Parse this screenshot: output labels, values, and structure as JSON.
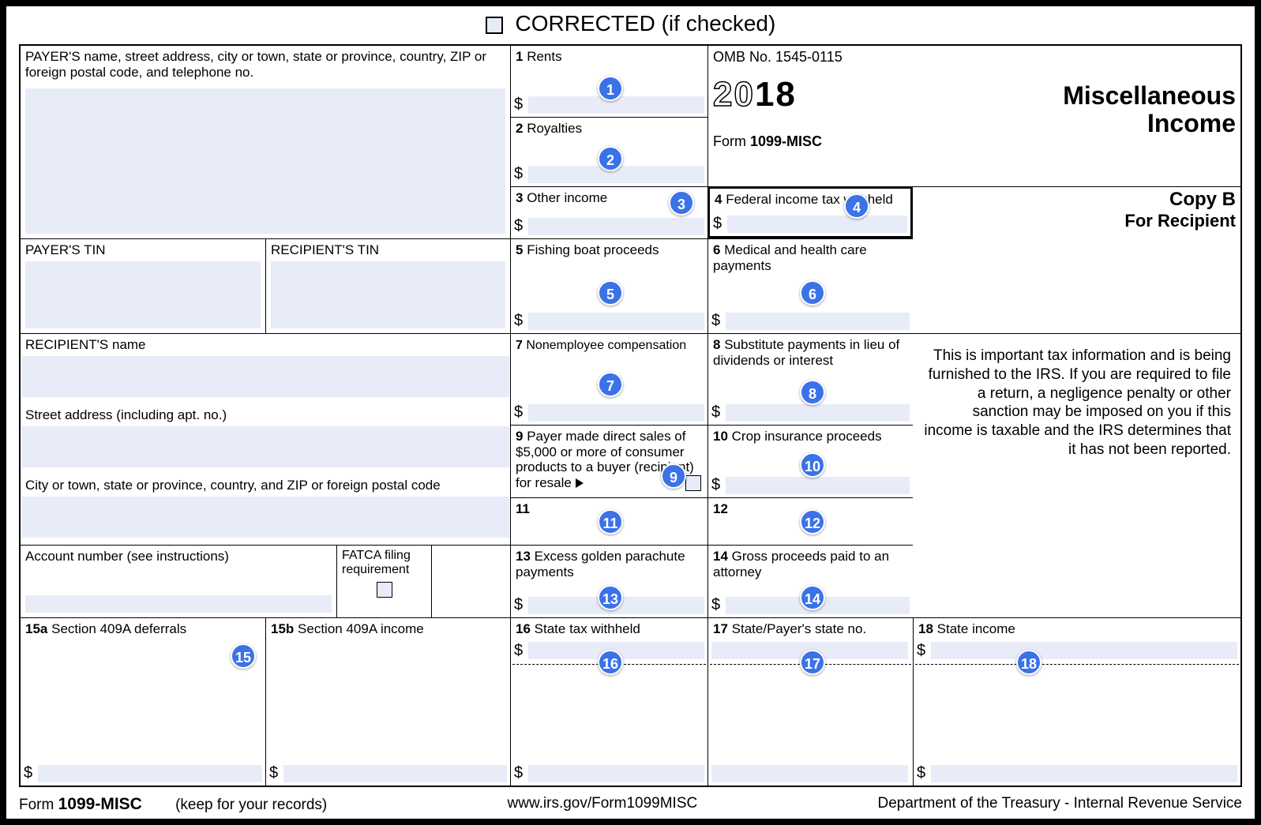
{
  "header": {
    "corrected_label": "CORRECTED (if checked)"
  },
  "payer": {
    "info_label": "PAYER'S name, street address, city or town, state or province, country, ZIP or foreign postal code, and telephone no.",
    "tin_label": "PAYER'S TIN"
  },
  "recipient": {
    "tin_label": "RECIPIENT'S TIN",
    "name_label": "RECIPIENT'S name",
    "street_label": "Street address (including apt. no.)",
    "city_label": "City or town, state or province, country, and ZIP or foreign postal code",
    "account_label": "Account number (see instructions)",
    "fatca_label": "FATCA filing requirement"
  },
  "boxes": {
    "b1": {
      "num": "1",
      "label": "Rents"
    },
    "b2": {
      "num": "2",
      "label": "Royalties"
    },
    "b3": {
      "num": "3",
      "label": "Other income"
    },
    "b4": {
      "num": "4",
      "label": "Federal income tax withheld"
    },
    "b5": {
      "num": "5",
      "label": "Fishing boat proceeds"
    },
    "b6": {
      "num": "6",
      "label": "Medical and health care payments"
    },
    "b7": {
      "num": "7",
      "label": "Nonemployee compensation"
    },
    "b8": {
      "num": "8",
      "label": "Substitute payments in lieu of dividends or interest"
    },
    "b9": {
      "num": "9",
      "label": "Payer made direct sales of $5,000 or more of consumer products to a buyer (recipient) for resale"
    },
    "b10": {
      "num": "10",
      "label": "Crop insurance proceeds"
    },
    "b11": {
      "num": "11",
      "label": ""
    },
    "b12": {
      "num": "12",
      "label": ""
    },
    "b13": {
      "num": "13",
      "label": "Excess golden parachute payments"
    },
    "b14": {
      "num": "14",
      "label": "Gross proceeds paid to an attorney"
    },
    "b15a": {
      "num": "15a",
      "label": "Section 409A deferrals"
    },
    "b15b": {
      "num": "15b",
      "label": "Section 409A income"
    },
    "b16": {
      "num": "16",
      "label": "State tax withheld"
    },
    "b17": {
      "num": "17",
      "label": "State/Payer's state no."
    },
    "b18": {
      "num": "18",
      "label": "State income"
    }
  },
  "right": {
    "omb": "OMB No. 1545-0115",
    "year_a": "20",
    "year_b": "18",
    "form_label_prefix": "Form ",
    "form_label": "1099-MISC",
    "title1": "Miscellaneous",
    "title2": "Income",
    "copyb": "Copy B",
    "for_recipient": "For Recipient",
    "tax_info": "This is important tax information and is being furnished to the IRS. If you are required to file a return, a negligence penalty or other sanction may be imposed on you if this income is taxable and the IRS determines that it has not been reported."
  },
  "footer": {
    "form_prefix": "Form ",
    "form": "1099-MISC",
    "keep": "(keep for your records)",
    "url": "www.irs.gov/Form1099MISC",
    "dept": "Department of the Treasury - Internal Revenue Service"
  },
  "annotations": {
    "a1": "1",
    "a2": "2",
    "a3": "3",
    "a4": "4",
    "a5": "5",
    "a6": "6",
    "a7": "7",
    "a8": "8",
    "a9": "9",
    "a10": "10",
    "a11": "11",
    "a12": "12",
    "a13": "13",
    "a14": "14",
    "a15": "15",
    "a16": "16",
    "a17": "17",
    "a18": "18"
  }
}
